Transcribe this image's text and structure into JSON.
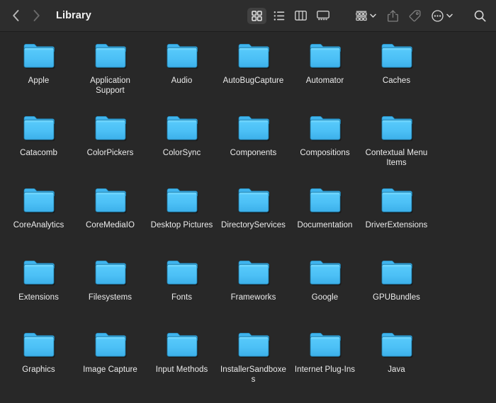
{
  "window": {
    "title": "Library",
    "app": "Finder",
    "background": "#282828",
    "toolbar_background": "#2d2d2d"
  },
  "toolbar": {
    "navigation": {
      "back_label": "Back",
      "back_icon": "chevron-left-icon",
      "back_enabled": true,
      "forward_label": "Forward",
      "forward_icon": "chevron-right-icon",
      "forward_enabled": false
    },
    "view_modes": [
      {
        "id": "icon",
        "label": "Icon View",
        "icon": "grid-icon",
        "selected": true
      },
      {
        "id": "list",
        "label": "List View",
        "icon": "list-icon",
        "selected": false
      },
      {
        "id": "column",
        "label": "Column View",
        "icon": "columns-icon",
        "selected": false
      },
      {
        "id": "gallery",
        "label": "Gallery View",
        "icon": "gallery-icon",
        "selected": false
      }
    ],
    "actions": [
      {
        "id": "group-by",
        "label": "Group Items",
        "icon": "group-by-icon",
        "has_chevron": true,
        "dimmed": false
      },
      {
        "id": "share",
        "label": "Share",
        "icon": "share-icon",
        "has_chevron": false,
        "dimmed": true
      },
      {
        "id": "tags",
        "label": "Edit Tags",
        "icon": "tag-icon",
        "has_chevron": false,
        "dimmed": true
      },
      {
        "id": "more",
        "label": "More",
        "icon": "ellipsis-circle-icon",
        "has_chevron": true,
        "dimmed": false
      }
    ],
    "search": {
      "label": "Search",
      "icon": "search-icon",
      "placeholder": "Search"
    }
  },
  "folder_colors": {
    "body_top": "#55c9fa",
    "body_bottom": "#3fb4ed",
    "tab": "#3cb2ec",
    "outline": "#1b6f99",
    "shadow": "#0f0f0f"
  },
  "content": {
    "view": "icon",
    "columns": 6,
    "items": [
      {
        "name": "Apple",
        "kind": "folder"
      },
      {
        "name": "Application Support",
        "kind": "folder"
      },
      {
        "name": "Audio",
        "kind": "folder"
      },
      {
        "name": "AutoBugCapture",
        "kind": "folder"
      },
      {
        "name": "Automator",
        "kind": "folder"
      },
      {
        "name": "Caches",
        "kind": "folder"
      },
      {
        "name": "Catacomb",
        "kind": "folder"
      },
      {
        "name": "ColorPickers",
        "kind": "folder"
      },
      {
        "name": "ColorSync",
        "kind": "folder"
      },
      {
        "name": "Components",
        "kind": "folder"
      },
      {
        "name": "Compositions",
        "kind": "folder"
      },
      {
        "name": "Contextual Menu Items",
        "kind": "folder"
      },
      {
        "name": "CoreAnalytics",
        "kind": "folder"
      },
      {
        "name": "CoreMediaIO",
        "kind": "folder"
      },
      {
        "name": "Desktop Pictures",
        "kind": "folder"
      },
      {
        "name": "DirectoryServices",
        "kind": "folder"
      },
      {
        "name": "Documentation",
        "kind": "folder"
      },
      {
        "name": "DriverExtensions",
        "kind": "folder"
      },
      {
        "name": "Extensions",
        "kind": "folder"
      },
      {
        "name": "Filesystems",
        "kind": "folder"
      },
      {
        "name": "Fonts",
        "kind": "folder"
      },
      {
        "name": "Frameworks",
        "kind": "folder"
      },
      {
        "name": "Google",
        "kind": "folder"
      },
      {
        "name": "GPUBundles",
        "kind": "folder"
      },
      {
        "name": "Graphics",
        "kind": "folder"
      },
      {
        "name": "Image Capture",
        "kind": "folder"
      },
      {
        "name": "Input Methods",
        "kind": "folder"
      },
      {
        "name": "InstallerSandboxes",
        "kind": "folder"
      },
      {
        "name": "Internet Plug-Ins",
        "kind": "folder"
      },
      {
        "name": "Java",
        "kind": "folder"
      }
    ]
  }
}
